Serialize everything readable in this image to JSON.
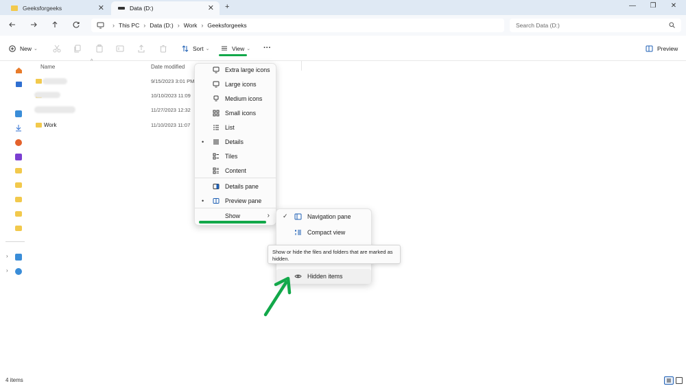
{
  "tabs": [
    {
      "label": "Geeksforgeeks",
      "close": "✕"
    },
    {
      "label": "Data (D:)",
      "close": "✕"
    }
  ],
  "new_tab": "+",
  "window_controls": {
    "minimize": "—",
    "restore": "❐",
    "close": "✕"
  },
  "breadcrumbs": [
    "This PC",
    "Data (D:)",
    "Work",
    "Geeksforgeeks"
  ],
  "search": {
    "placeholder": "Search Data (D:)"
  },
  "toolbar": {
    "new_label": "New",
    "sort_label": "Sort",
    "view_label": "View",
    "more_label": "···",
    "preview_label": "Preview"
  },
  "file_list": {
    "columns": {
      "name": "Name",
      "date": "Date modified"
    },
    "rows": [
      {
        "name": "",
        "date": "9/15/2023 3:01 PM"
      },
      {
        "name": "",
        "date": "10/10/2023 11:09"
      },
      {
        "name": "",
        "date": "11/27/2023 12:32"
      },
      {
        "name": "Work",
        "date": "11/10/2023 11:07"
      }
    ]
  },
  "view_menu": {
    "items": [
      {
        "label": "Extra large icons",
        "icon": "monitor-icon"
      },
      {
        "label": "Large icons",
        "icon": "monitor-icon"
      },
      {
        "label": "Medium icons",
        "icon": "monitor-icon"
      },
      {
        "label": "Small icons",
        "icon": "grid-icon"
      },
      {
        "label": "List",
        "icon": "list-icon"
      },
      {
        "label": "Details",
        "icon": "details-icon",
        "bullet": "•"
      },
      {
        "label": "Tiles",
        "icon": "tiles-icon"
      },
      {
        "label": "Content",
        "icon": "content-icon"
      },
      {
        "label": "Details pane",
        "icon": "details-pane-icon"
      },
      {
        "label": "Preview pane",
        "icon": "preview-pane-icon",
        "bullet": "•"
      },
      {
        "label": "Show",
        "icon": "",
        "chevron": "›"
      }
    ]
  },
  "show_submenu": {
    "items": [
      {
        "label": "Navigation pane",
        "check": "✓"
      },
      {
        "label": "Compact view"
      },
      {
        "label": "Hidden items"
      }
    ]
  },
  "tooltip": {
    "text": "Show or hide the files and folders that are marked as hidden."
  },
  "status": {
    "item_count": "4 items"
  },
  "colors": {
    "accent": "#12a84a",
    "folder": "#f2c94c",
    "tabbar": "#dfe9f4"
  }
}
